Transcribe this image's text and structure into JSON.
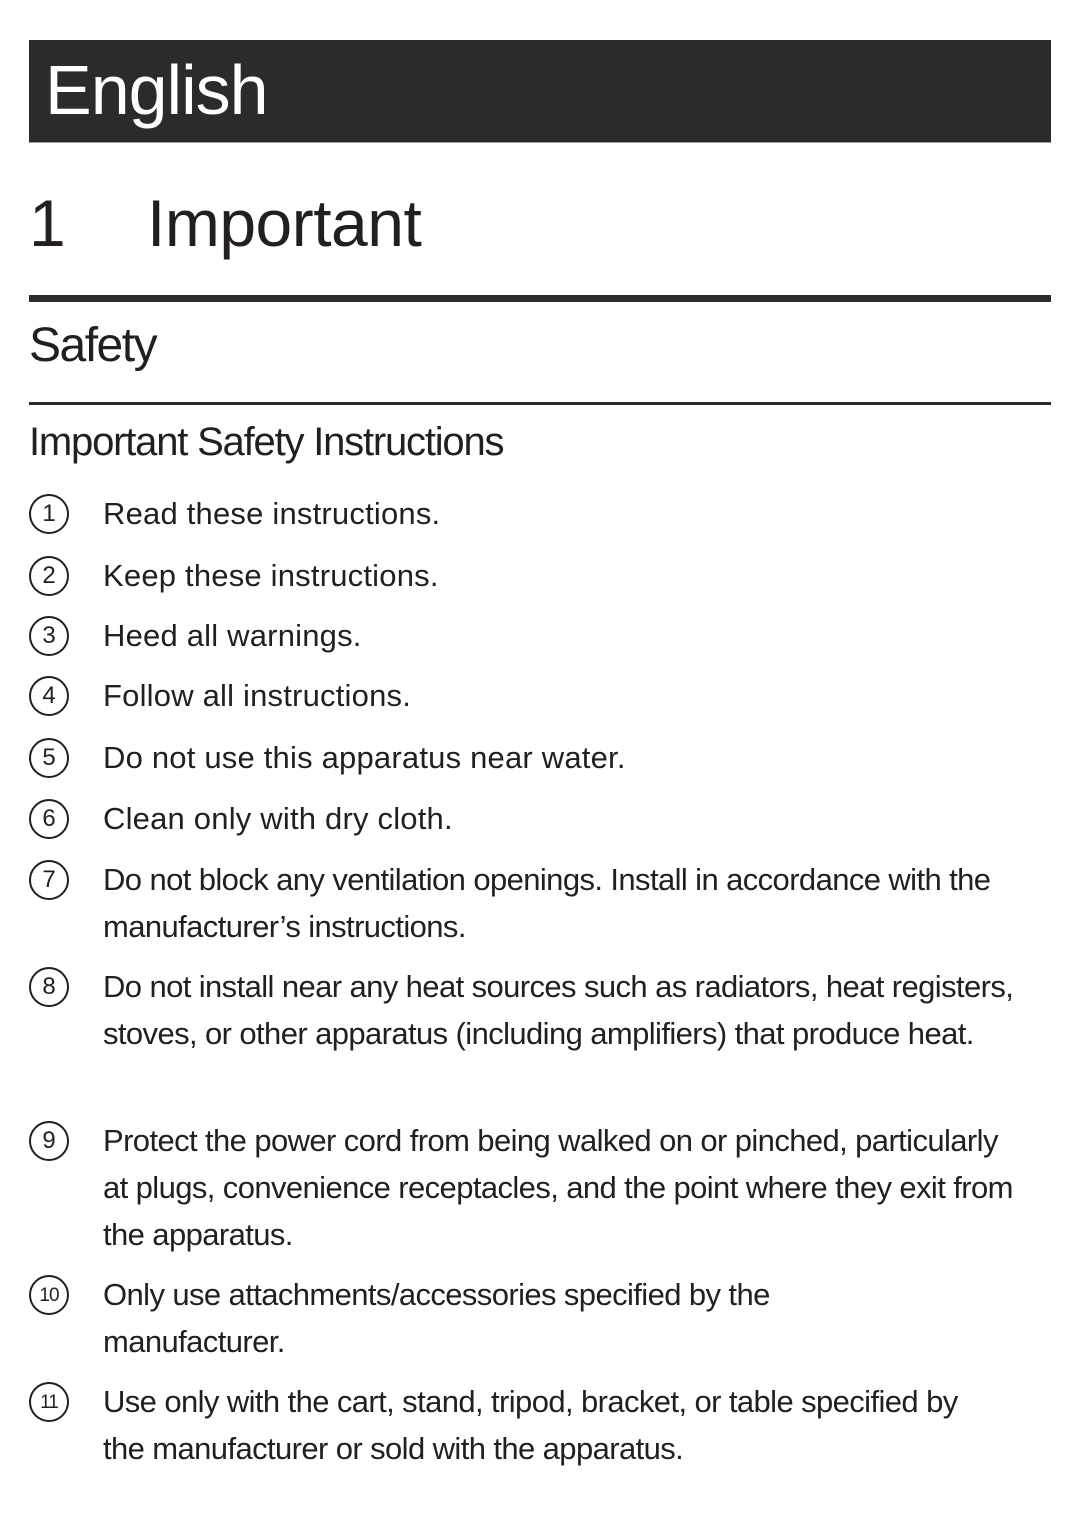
{
  "header": {
    "language": "English"
  },
  "chapter": {
    "number": "1",
    "title": "Important"
  },
  "section": {
    "title": "Safety"
  },
  "subsection": {
    "title": "Important Safety Instructions"
  },
  "instructions": [
    {
      "number": "1",
      "text": "Read these instructions."
    },
    {
      "number": "2",
      "text": "Keep these instructions."
    },
    {
      "number": "3",
      "text": "Heed all warnings."
    },
    {
      "number": "4",
      "text": "Follow all instructions."
    },
    {
      "number": "5",
      "text": "Do not use this apparatus near water."
    },
    {
      "number": "6",
      "text": "Clean only with dry cloth."
    },
    {
      "number": "7",
      "text": "Do not block any ventilation openings. Install in accordance with the manufacturer’s instructions."
    },
    {
      "number": "8",
      "text": "Do not install near any heat sources such as radiators, heat registers, stoves, or other apparatus (including amplifiers) that produce heat."
    },
    {
      "number": "9",
      "text": "Protect the power cord from being walked on or pinched, particularly at plugs, convenience receptacles, and the point where they exit from the apparatus."
    },
    {
      "number": "10",
      "text": "Only use attachments/accessories specified by the manufacturer."
    },
    {
      "number": "11",
      "text": "Use only with the cart, stand, tripod, bracket, or table specified by the manufacturer or sold with the apparatus."
    }
  ]
}
